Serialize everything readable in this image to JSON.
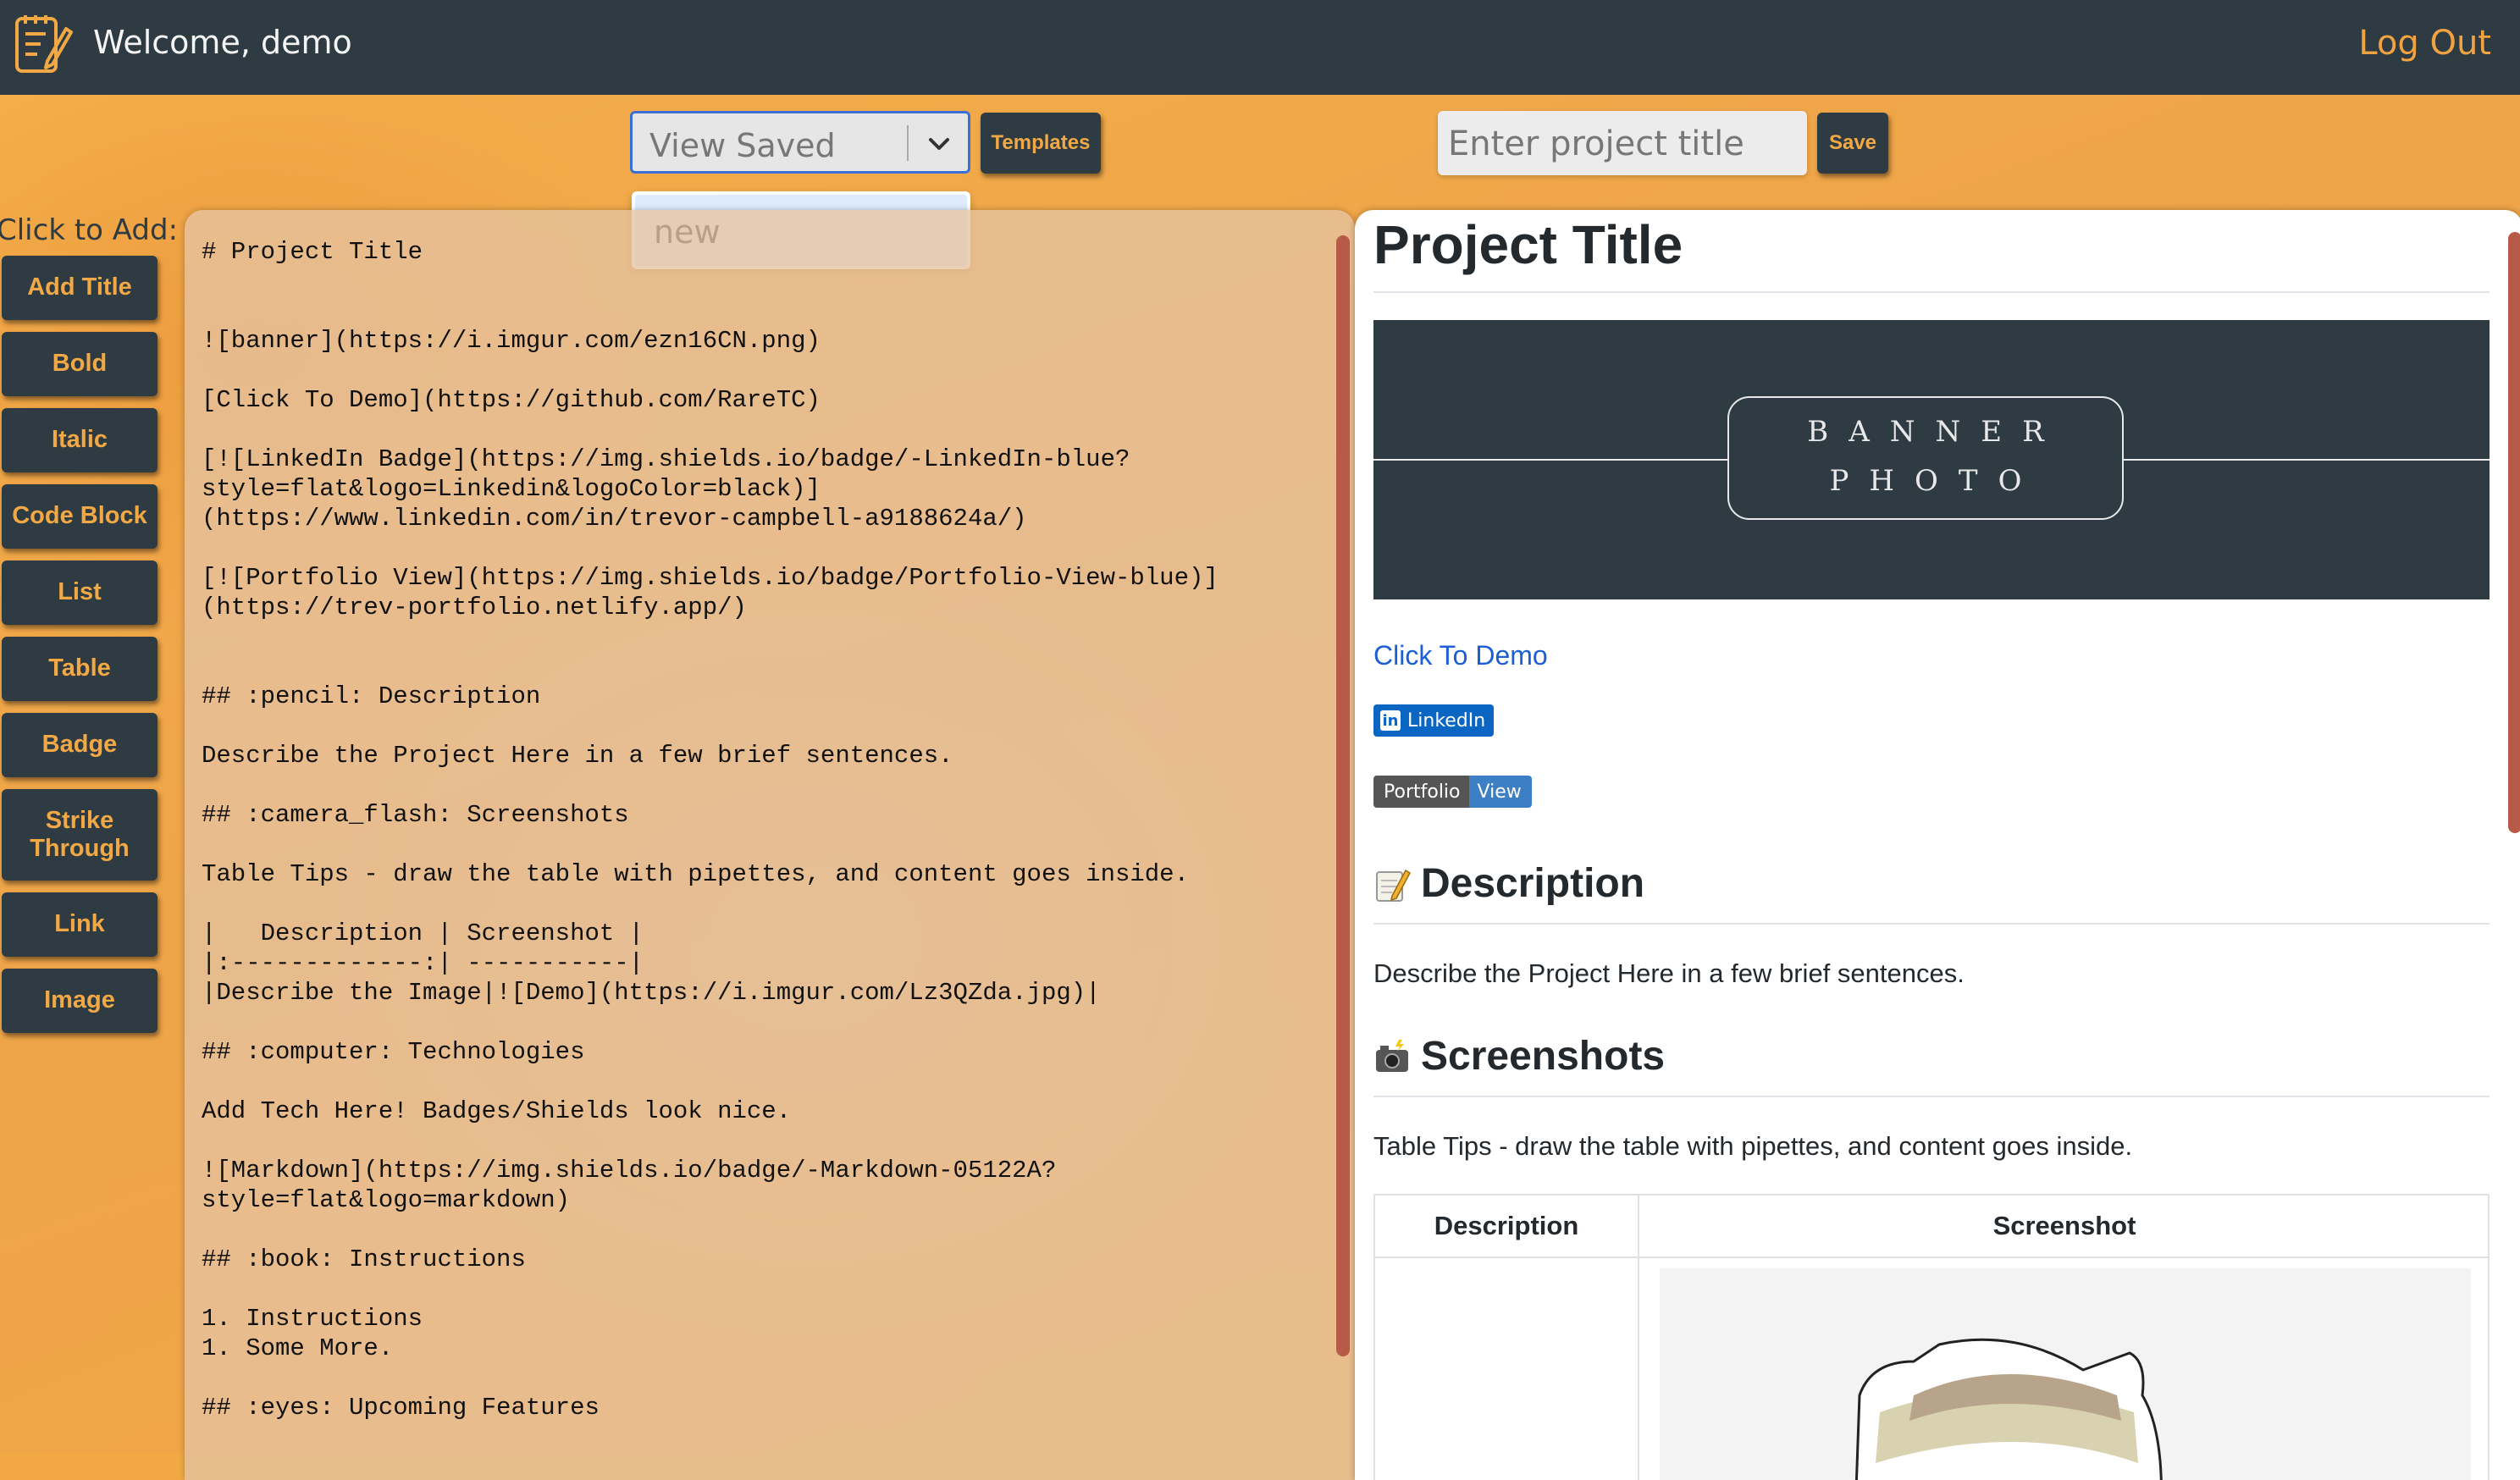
{
  "header": {
    "welcome": "Welcome, demo",
    "logout": "Log Out",
    "logo_icon": "edit-document-icon"
  },
  "toolbar": {
    "select_value": "View Saved",
    "select_options": [
      "new"
    ],
    "templates_label": "Templates",
    "title_placeholder": "Enter project title",
    "save_label": "Save"
  },
  "sidebar": {
    "heading": "Click to Add:",
    "buttons": [
      "Add Title",
      "Bold",
      "Italic",
      "Code Block",
      "List",
      "Table",
      "Badge",
      "Strike Through",
      "Link",
      "Image"
    ]
  },
  "editor": {
    "content": "# Project Title\n\n\n![banner](https://i.imgur.com/ezn16CN.png)\n\n[Click To Demo](https://github.com/RareTC)\n\n[![LinkedIn Badge](https://img.shields.io/badge/-LinkedIn-blue?\nstyle=flat&logo=Linkedin&logoColor=black)]\n(https://www.linkedin.com/in/trevor-campbell-a9188624a/)\n\n[![Portfolio View](https://img.shields.io/badge/Portfolio-View-blue)]\n(https://trev-portfolio.netlify.app/)\n\n\n## :pencil: Description\n\nDescribe the Project Here in a few brief sentences.\n\n## :camera_flash: Screenshots\n\nTable Tips - draw the table with pipettes, and content goes inside.\n\n|   Description | Screenshot |\n|:-------------:| -----------|\n|Describe the Image|![Demo](https://i.imgur.com/Lz3QZda.jpg)|\n\n## :computer: Technologies\n\nAdd Tech Here! Badges/Shields look nice.\n\n![Markdown](https://img.shields.io/badge/-Markdown-05122A?\nstyle=flat&logo=markdown)\n\n## :book: Instructions\n\n1. Instructions\n1. Some More.\n\n## :eyes: Upcoming Features"
  },
  "preview": {
    "title": "Project Title",
    "banner_line1": "BANNER",
    "banner_line2": "PHOTO",
    "demo_link": "Click To Demo",
    "linkedin_badge": "LinkedIn",
    "portfolio_badge_left": "Portfolio",
    "portfolio_badge_right": "View",
    "description_heading": "Description",
    "description_text": "Describe the Project Here in a few brief sentences.",
    "screenshots_heading": "Screenshots",
    "screenshots_text": "Table Tips - draw the table with pipettes, and content goes inside.",
    "table_headers": [
      "Description",
      "Screenshot"
    ]
  },
  "colors": {
    "accent": "#f2a945",
    "dark": "#2e3b42",
    "link": "#1a5fd6",
    "scrollbar": "#b85a48"
  }
}
